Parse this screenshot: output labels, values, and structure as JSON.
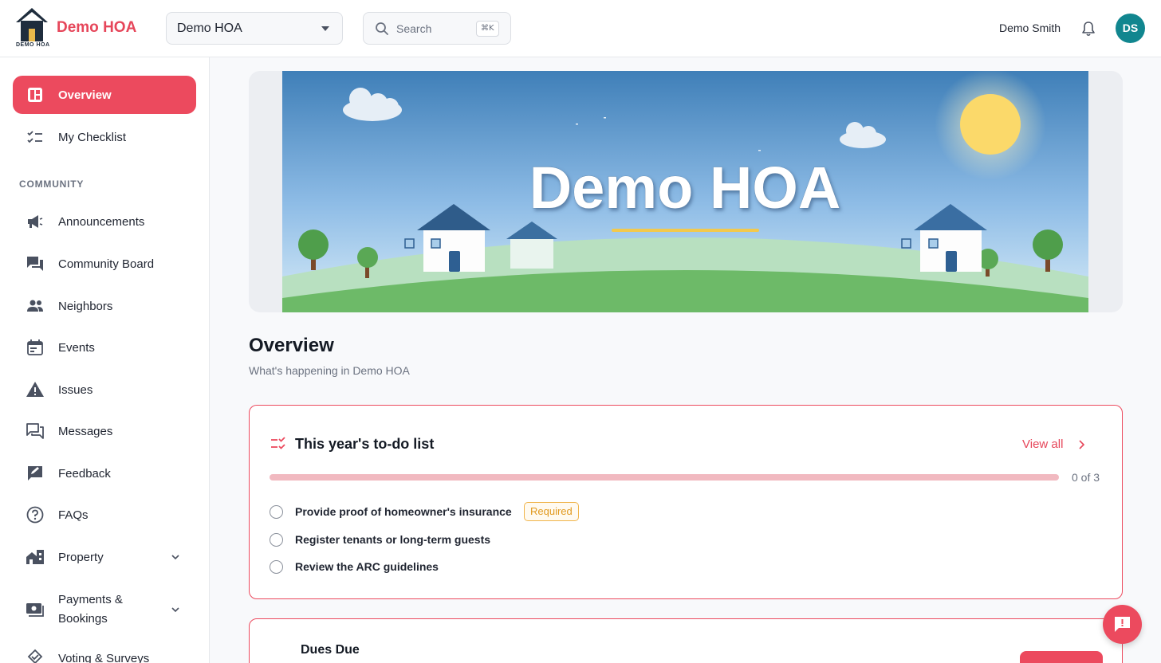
{
  "header": {
    "brand": "Demo HOA",
    "logo_caption": "DEMO HOA",
    "org_selector": "Demo HOA",
    "search_placeholder": "Search",
    "search_shortcut": "⌘K",
    "user_name": "Demo Smith",
    "user_initials": "DS"
  },
  "sidebar": {
    "section_community": "COMMUNITY",
    "items": [
      {
        "label": "Overview",
        "icon": "dashboard-icon"
      },
      {
        "label": "My Checklist",
        "icon": "checklist-icon"
      },
      {
        "label": "Announcements",
        "icon": "megaphone-icon"
      },
      {
        "label": "Community Board",
        "icon": "forum-icon"
      },
      {
        "label": "Neighbors",
        "icon": "people-icon"
      },
      {
        "label": "Events",
        "icon": "calendar-icon"
      },
      {
        "label": "Issues",
        "icon": "warning-icon"
      },
      {
        "label": "Messages",
        "icon": "messages-icon"
      },
      {
        "label": "Feedback",
        "icon": "feedback-icon"
      },
      {
        "label": "FAQs",
        "icon": "help-circle-icon"
      },
      {
        "label": "Property",
        "icon": "property-icon"
      },
      {
        "label": "Payments & Bookings",
        "icon": "payments-icon"
      },
      {
        "label": "Voting & Surveys",
        "icon": "vote-icon"
      }
    ]
  },
  "banner": {
    "title": "Demo HOA"
  },
  "main": {
    "title": "Overview",
    "subtitle": "What's happening in Demo HOA",
    "todo": {
      "title": "This year's to-do list",
      "view_all": "View all",
      "progress_text": "0 of 3",
      "progress_fraction": 0,
      "tasks": [
        {
          "label": "Provide proof of homeowner's insurance",
          "badge": "Required"
        },
        {
          "label": "Register tenants or long-term guests"
        },
        {
          "label": "Review the ARC guidelines"
        }
      ]
    },
    "dues_card": {
      "title": "Dues Due"
    }
  },
  "colors": {
    "accent": "#ec4a5e",
    "avatar": "#11868f",
    "badge": "#e1991e"
  }
}
